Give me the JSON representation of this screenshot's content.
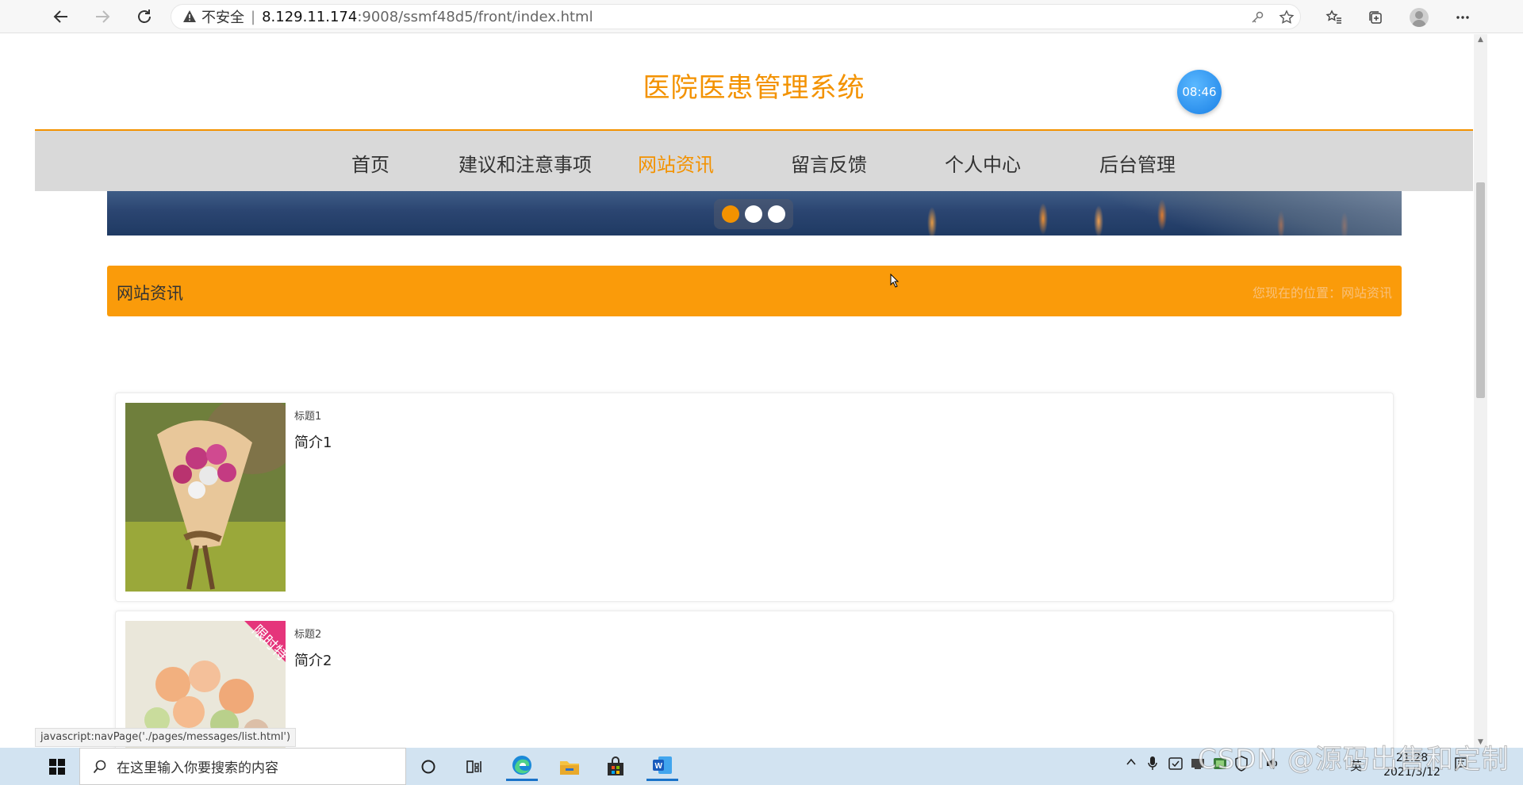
{
  "browser": {
    "insecure_label": "不安全",
    "url_host": "8.129.11.174",
    "url_path": ":9008/ssmf48d5/front/index.html"
  },
  "site": {
    "title": "医院医患管理系统",
    "clock": "08:46"
  },
  "nav": {
    "items": [
      {
        "label": "首页"
      },
      {
        "label": "建议和注意事项"
      },
      {
        "label": "网站资讯"
      },
      {
        "label": "留言反馈"
      },
      {
        "label": "个人中心"
      },
      {
        "label": "后台管理"
      }
    ],
    "active": "网站资讯"
  },
  "section": {
    "title": "网站资讯",
    "breadcrumb": "您现在的位置：网站资讯"
  },
  "news": [
    {
      "title": "标题1",
      "summary": "简介1"
    },
    {
      "title": "标题2",
      "summary": "简介2",
      "ribbon": "限时特"
    }
  ],
  "status_url": "javascript:navPage('./pages/messages/list.html')",
  "taskbar": {
    "search_placeholder": "在这里输入你要搜索的内容",
    "ime": "英",
    "time": "21:28",
    "date": "2021/3/12"
  },
  "watermark": "CSDN @源码出售和定制",
  "colors": {
    "accent": "#f39200",
    "section_bar": "#fa9b0a",
    "nav_bg": "#d9d9d9"
  }
}
